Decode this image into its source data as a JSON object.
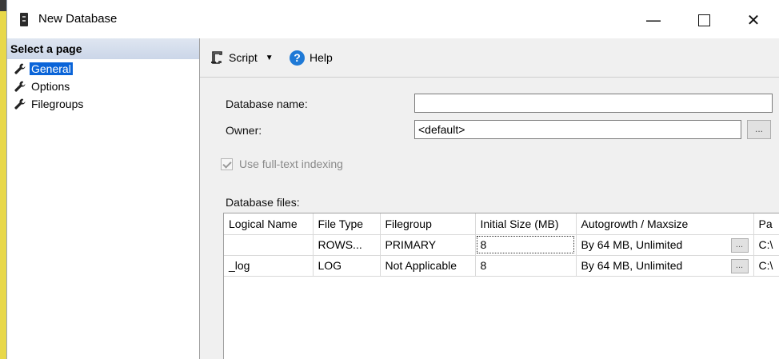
{
  "window": {
    "title": "New Database",
    "minimize_label": "—",
    "close_label": "✕"
  },
  "left_pane": {
    "header": "Select a page",
    "items": [
      {
        "label": "General",
        "selected": true
      },
      {
        "label": "Options",
        "selected": false
      },
      {
        "label": "Filegroups",
        "selected": false
      }
    ]
  },
  "toolbar": {
    "script_label": "Script",
    "script_arrow": "▼",
    "help_label": "Help",
    "help_glyph": "?"
  },
  "form": {
    "database_name_label": "Database name:",
    "database_name_value": "",
    "owner_label": "Owner:",
    "owner_value": "<default>",
    "browse_label": "...",
    "fulltext_label": "Use full-text indexing",
    "fulltext_checked": true,
    "fulltext_enabled": false,
    "database_files_label": "Database files:"
  },
  "files_table": {
    "columns": [
      "Logical Name",
      "File Type",
      "Filegroup",
      "Initial Size (MB)",
      "Autogrowth / Maxsize",
      "Pa"
    ],
    "rows": [
      [
        "",
        "ROWS...",
        "PRIMARY",
        "8",
        "By 64 MB, Unlimited",
        "C:\\"
      ],
      [
        "_log",
        "LOG",
        "Not Applicable",
        "8",
        "By 64 MB, Unlimited",
        "C:\\"
      ]
    ],
    "cell_button_label": "..."
  },
  "colors": {
    "selection": "#0a64d8",
    "header_gradient": "#cbd6e8",
    "help_icon": "#1e79d6"
  }
}
